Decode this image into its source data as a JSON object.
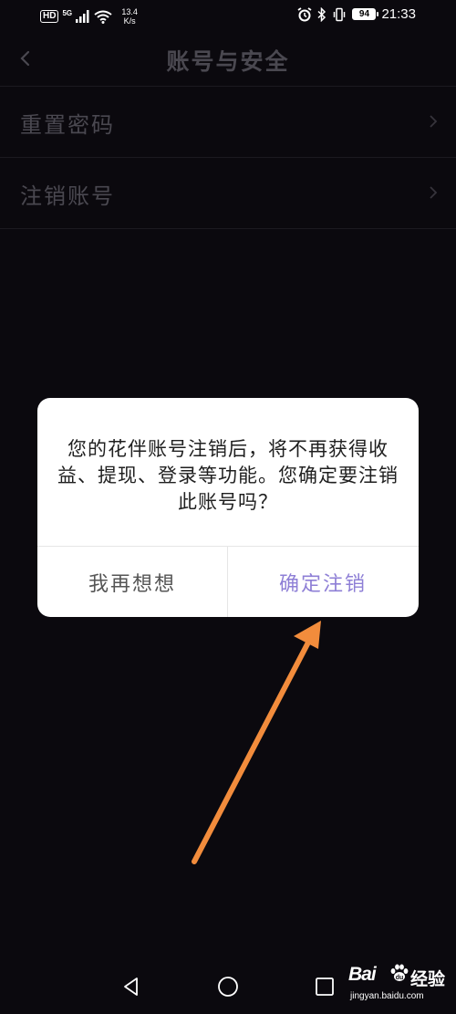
{
  "status_bar": {
    "hd": "HD",
    "network": "5G",
    "speed_value": "13.4",
    "speed_unit": "K/s",
    "battery": "94",
    "time": "21:33"
  },
  "header": {
    "title": "账号与安全"
  },
  "menu": {
    "items": [
      {
        "label": "重置密码"
      },
      {
        "label": "注销账号"
      }
    ]
  },
  "dialog": {
    "message": "您的花伴账号注销后，将不再获得收益、提现、登录等功能。您确定要注销此账号吗？",
    "cancel_label": "我再想想",
    "confirm_label": "确定注销"
  },
  "watermark": {
    "brand": "Bai",
    "suffix": "经验",
    "url": "jingyan.baidu.com"
  },
  "colors": {
    "background": "#0b090e",
    "dimmed_text": "#4a4850",
    "confirm_accent": "#8e7fd6",
    "annotation_arrow": "#f28c3c"
  }
}
